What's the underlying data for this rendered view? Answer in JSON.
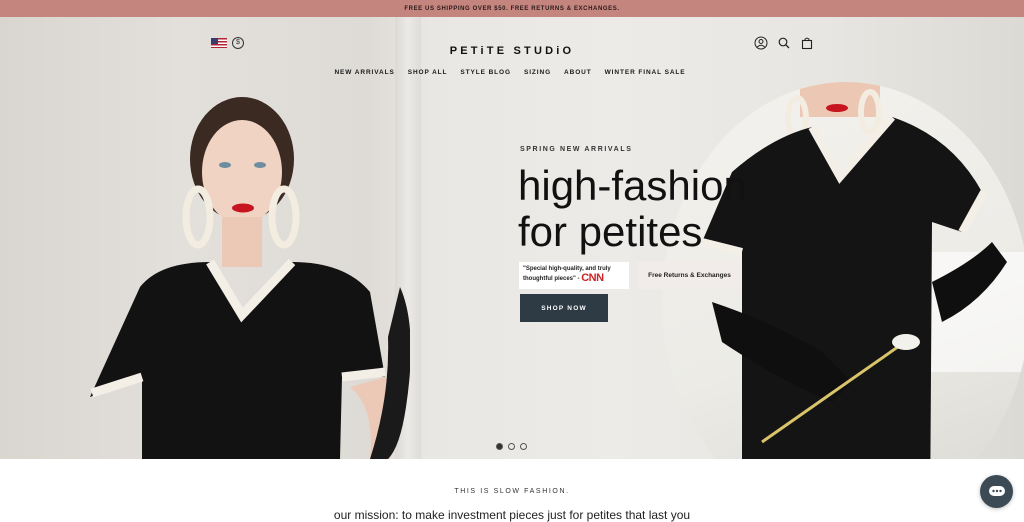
{
  "announcement": "FREE US SHIPPING OVER $50. FREE RETURNS & EXCHANGES.",
  "header": {
    "currency_symbol": "$",
    "logo": "PETiTE STUDiO",
    "icons": [
      "account-icon",
      "search-icon",
      "cart-icon"
    ]
  },
  "nav": [
    "NEW ARRIVALS",
    "SHOP ALL",
    "STYLE BLOG",
    "SIZING",
    "ABOUT",
    "WINTER FINAL SALE"
  ],
  "hero": {
    "eyebrow": "SPRING NEW ARRIVALS",
    "headline_line1": "high-fashion",
    "headline_line2": "for petites",
    "quote": "\"Special high-quality, and truly thoughtful pieces\" -",
    "quote_source": "CNN",
    "returns": "Free Returns & Exchanges",
    "cta": "SHOP NOW",
    "slides_total": 3,
    "slide_active": 1
  },
  "mission": {
    "eyebrow": "THIS IS SLOW FASHION.",
    "text": "our mission: to make investment pieces just for petites that last you"
  },
  "colors": {
    "announcement_bg": "#c4857f",
    "cta_bg": "#2e3a44",
    "chat_bg": "#3c4a55",
    "cnn_red": "#cc2424"
  }
}
